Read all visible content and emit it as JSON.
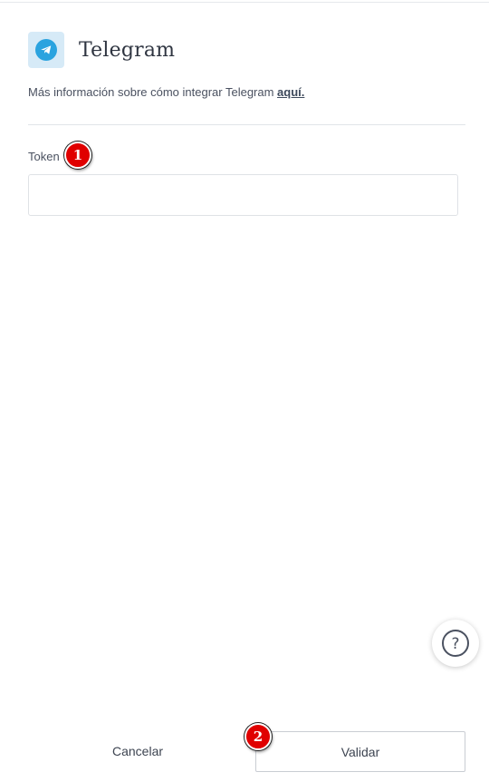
{
  "header": {
    "title": "Telegram",
    "logo_icon": "telegram-icon",
    "brand_color": "#2aa3df"
  },
  "info": {
    "text": "Más información sobre cómo integrar Telegram ",
    "link_label": "aquí."
  },
  "form": {
    "token_label": "Token",
    "token_value": "",
    "token_placeholder": ""
  },
  "annotations": {
    "badge_1": "1",
    "badge_2": "2"
  },
  "help": {
    "icon": "help-icon",
    "symbol": "?"
  },
  "footer": {
    "cancel_label": "Cancelar",
    "validate_label": "Validar"
  }
}
